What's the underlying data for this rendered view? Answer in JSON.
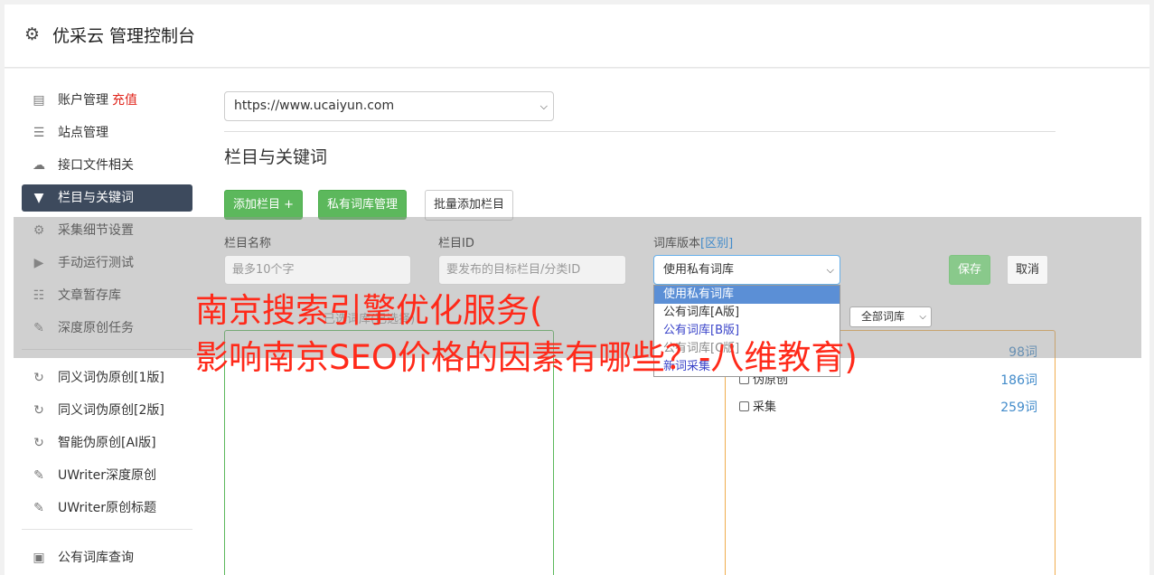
{
  "header": {
    "title": "优采云 管理控制台",
    "icon": "gear-icon"
  },
  "sidebar": {
    "items": [
      {
        "label": "账户管理",
        "badge": "充值",
        "icon": "bar-chart-icon"
      },
      {
        "label": "站点管理",
        "icon": "server-icon"
      },
      {
        "label": "接口文件相关",
        "icon": "cloud-upload-icon"
      },
      {
        "label": "栏目与关键词",
        "icon": "filter-icon",
        "active": true
      },
      {
        "label": "采集细节设置",
        "icon": "cogs-icon"
      },
      {
        "label": "手动运行测试",
        "icon": "play-circle-icon"
      },
      {
        "label": "文章暂存库",
        "icon": "database-icon"
      },
      {
        "label": "深度原创任务",
        "icon": "edit-icon"
      },
      {
        "label": "同义词伪原创[1版]",
        "icon": "refresh-icon"
      },
      {
        "label": "同义词伪原创[2版]",
        "icon": "refresh-icon"
      },
      {
        "label": "智能伪原创[AI版]",
        "icon": "refresh-icon"
      },
      {
        "label": "UWriter深度原创",
        "icon": "edit-icon"
      },
      {
        "label": "UWriter原创标题",
        "icon": "edit-icon"
      },
      {
        "label": "公有词库查询",
        "icon": "book-icon"
      }
    ]
  },
  "main": {
    "site_select": {
      "value": "https://www.ucaiyun.com"
    },
    "section_title": "栏目与关键词",
    "buttons": {
      "add_column": "添加栏目 +",
      "private_lib": "私有词库管理",
      "batch_add": "批量添加栏目"
    },
    "form": {
      "name_label": "栏目名称",
      "name_placeholder": "最多10个字",
      "id_label": "栏目ID",
      "id_placeholder": "要发布的目标栏目/分类ID",
      "version_label": "词库版本",
      "version_link": "[区别]",
      "version_value": "使用私有词库",
      "save": "保存",
      "cancel": "取消"
    },
    "dropdown_options": [
      "使用私有词库",
      "公有词库[A版]",
      "公有词库[B版]",
      "公有词库[C版]"
    ],
    "dropdown_extra": "新词采集",
    "lib_filter": "全部词库",
    "pane_left_label": "已选词库(已选择)",
    "libraries": [
      {
        "name": "",
        "count": "98词"
      },
      {
        "name": "伪原创",
        "count": "186词"
      },
      {
        "name": "采集",
        "count": "259词"
      }
    ]
  },
  "watermark": {
    "line1": "南京搜索引擎优化服务(",
    "line2": "影响南京SEO价格的因素有哪些？-八维教育)"
  },
  "colors": {
    "active_nav": "#3d4a5d",
    "green": "#5cb85c",
    "orange": "#f0ad4e",
    "link": "#428bca",
    "watermark": "#ff2a1a"
  }
}
